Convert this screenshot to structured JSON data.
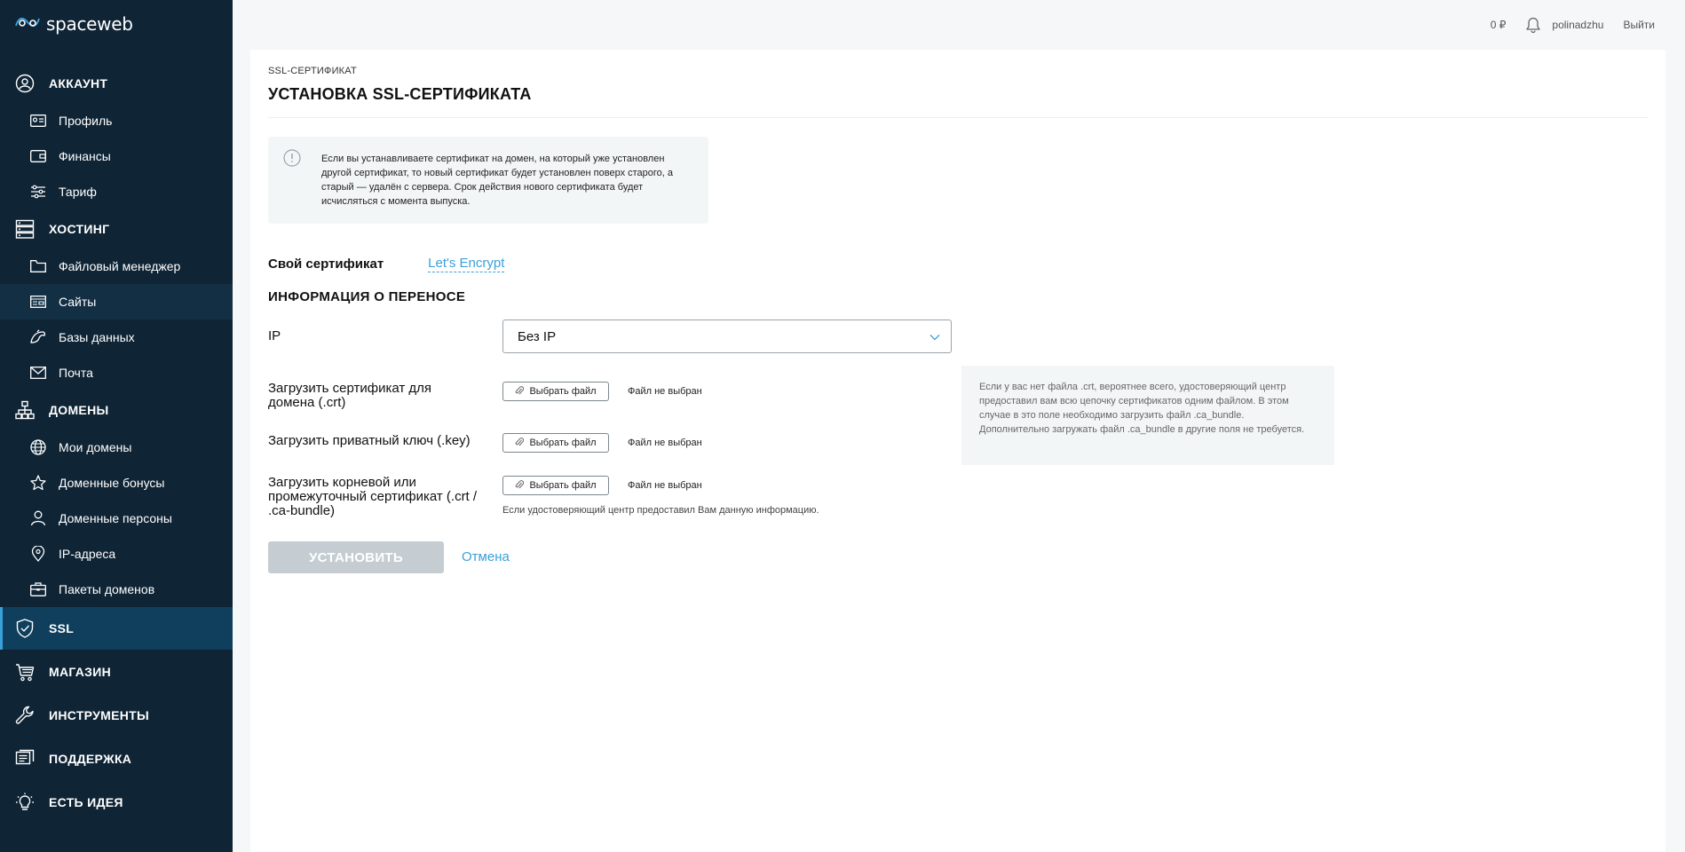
{
  "brand": {
    "logo_text": "spaceweb"
  },
  "topbar": {
    "balance": "0 ₽",
    "username": "polinadzhu",
    "logout": "Выйти"
  },
  "sidebar": {
    "account": {
      "label": "АККАУНТ",
      "items": [
        "Профиль",
        "Финансы",
        "Тариф"
      ]
    },
    "hosting": {
      "label": "ХОСТИНГ",
      "items": [
        "Файловый менеджер",
        "Сайты",
        "Базы данных",
        "Почта"
      ]
    },
    "domains": {
      "label": "ДОМЕНЫ",
      "items": [
        "Мои домены",
        "Доменные бонусы",
        "Доменные персоны",
        "IP-адреса",
        "Пакеты доменов"
      ]
    },
    "ssl": "SSL",
    "shop": "МАГАЗИН",
    "tools": "ИНСТРУМЕНТЫ",
    "support": "ПОДДЕРЖКА",
    "idea": "ЕСТЬ ИДЕЯ"
  },
  "page": {
    "breadcrumb": "SSL-СЕРТИФИКАТ",
    "title": "УСТАНОВКА SSL-СЕРТИФИКАТА",
    "notice": "Если вы устанавливаете сертификат на домен, на который уже установлен другой сертификат, то новый сертификат будет установлен поверх старого, а старый — удалён с сервера. Срок действия нового сертификата будет исчисляться с момента выпуска.",
    "tabs": {
      "own": "Свой сертификат",
      "letsencrypt": "Let's Encrypt"
    },
    "section_title": "ИНФОРМАЦИЯ О ПЕРЕНОСЕ",
    "ip": {
      "label": "IP",
      "value": "Без IP"
    },
    "upload_crt": {
      "label": "Загрузить сертификат для домена (.crt)",
      "button": "Выбрать файл",
      "status": "Файл не выбран"
    },
    "upload_key": {
      "label": "Загрузить приватный ключ (.key)",
      "button": "Выбрать файл",
      "status": "Файл не выбран"
    },
    "upload_bundle": {
      "label": "Загрузить корневой или промежуточный сертификат (.crt / .ca-bundle)",
      "button": "Выбрать файл",
      "status": "Файл не выбран",
      "hint": "Если удостоверяющий центр предоставил Вам данную информацию."
    },
    "side_hint": "Если у вас нет файла .crt, вероятнее всего, удостоверяющий центр предоставил вам всю цепочку сертификатов одним файлом. В этом случае в это поле необходимо загрузить файл .ca_bundle. Дополнительно загружать файл .ca_bundle в другие поля не требуется.",
    "install_button": "УСТАНОВИТЬ",
    "cancel_button": "Отмена"
  },
  "colors": {
    "sidebar_bg": "#0f2435",
    "active_bg": "#0f3f5c",
    "accent": "#3aa0d9",
    "button_disabled": "#c5cdd2"
  }
}
